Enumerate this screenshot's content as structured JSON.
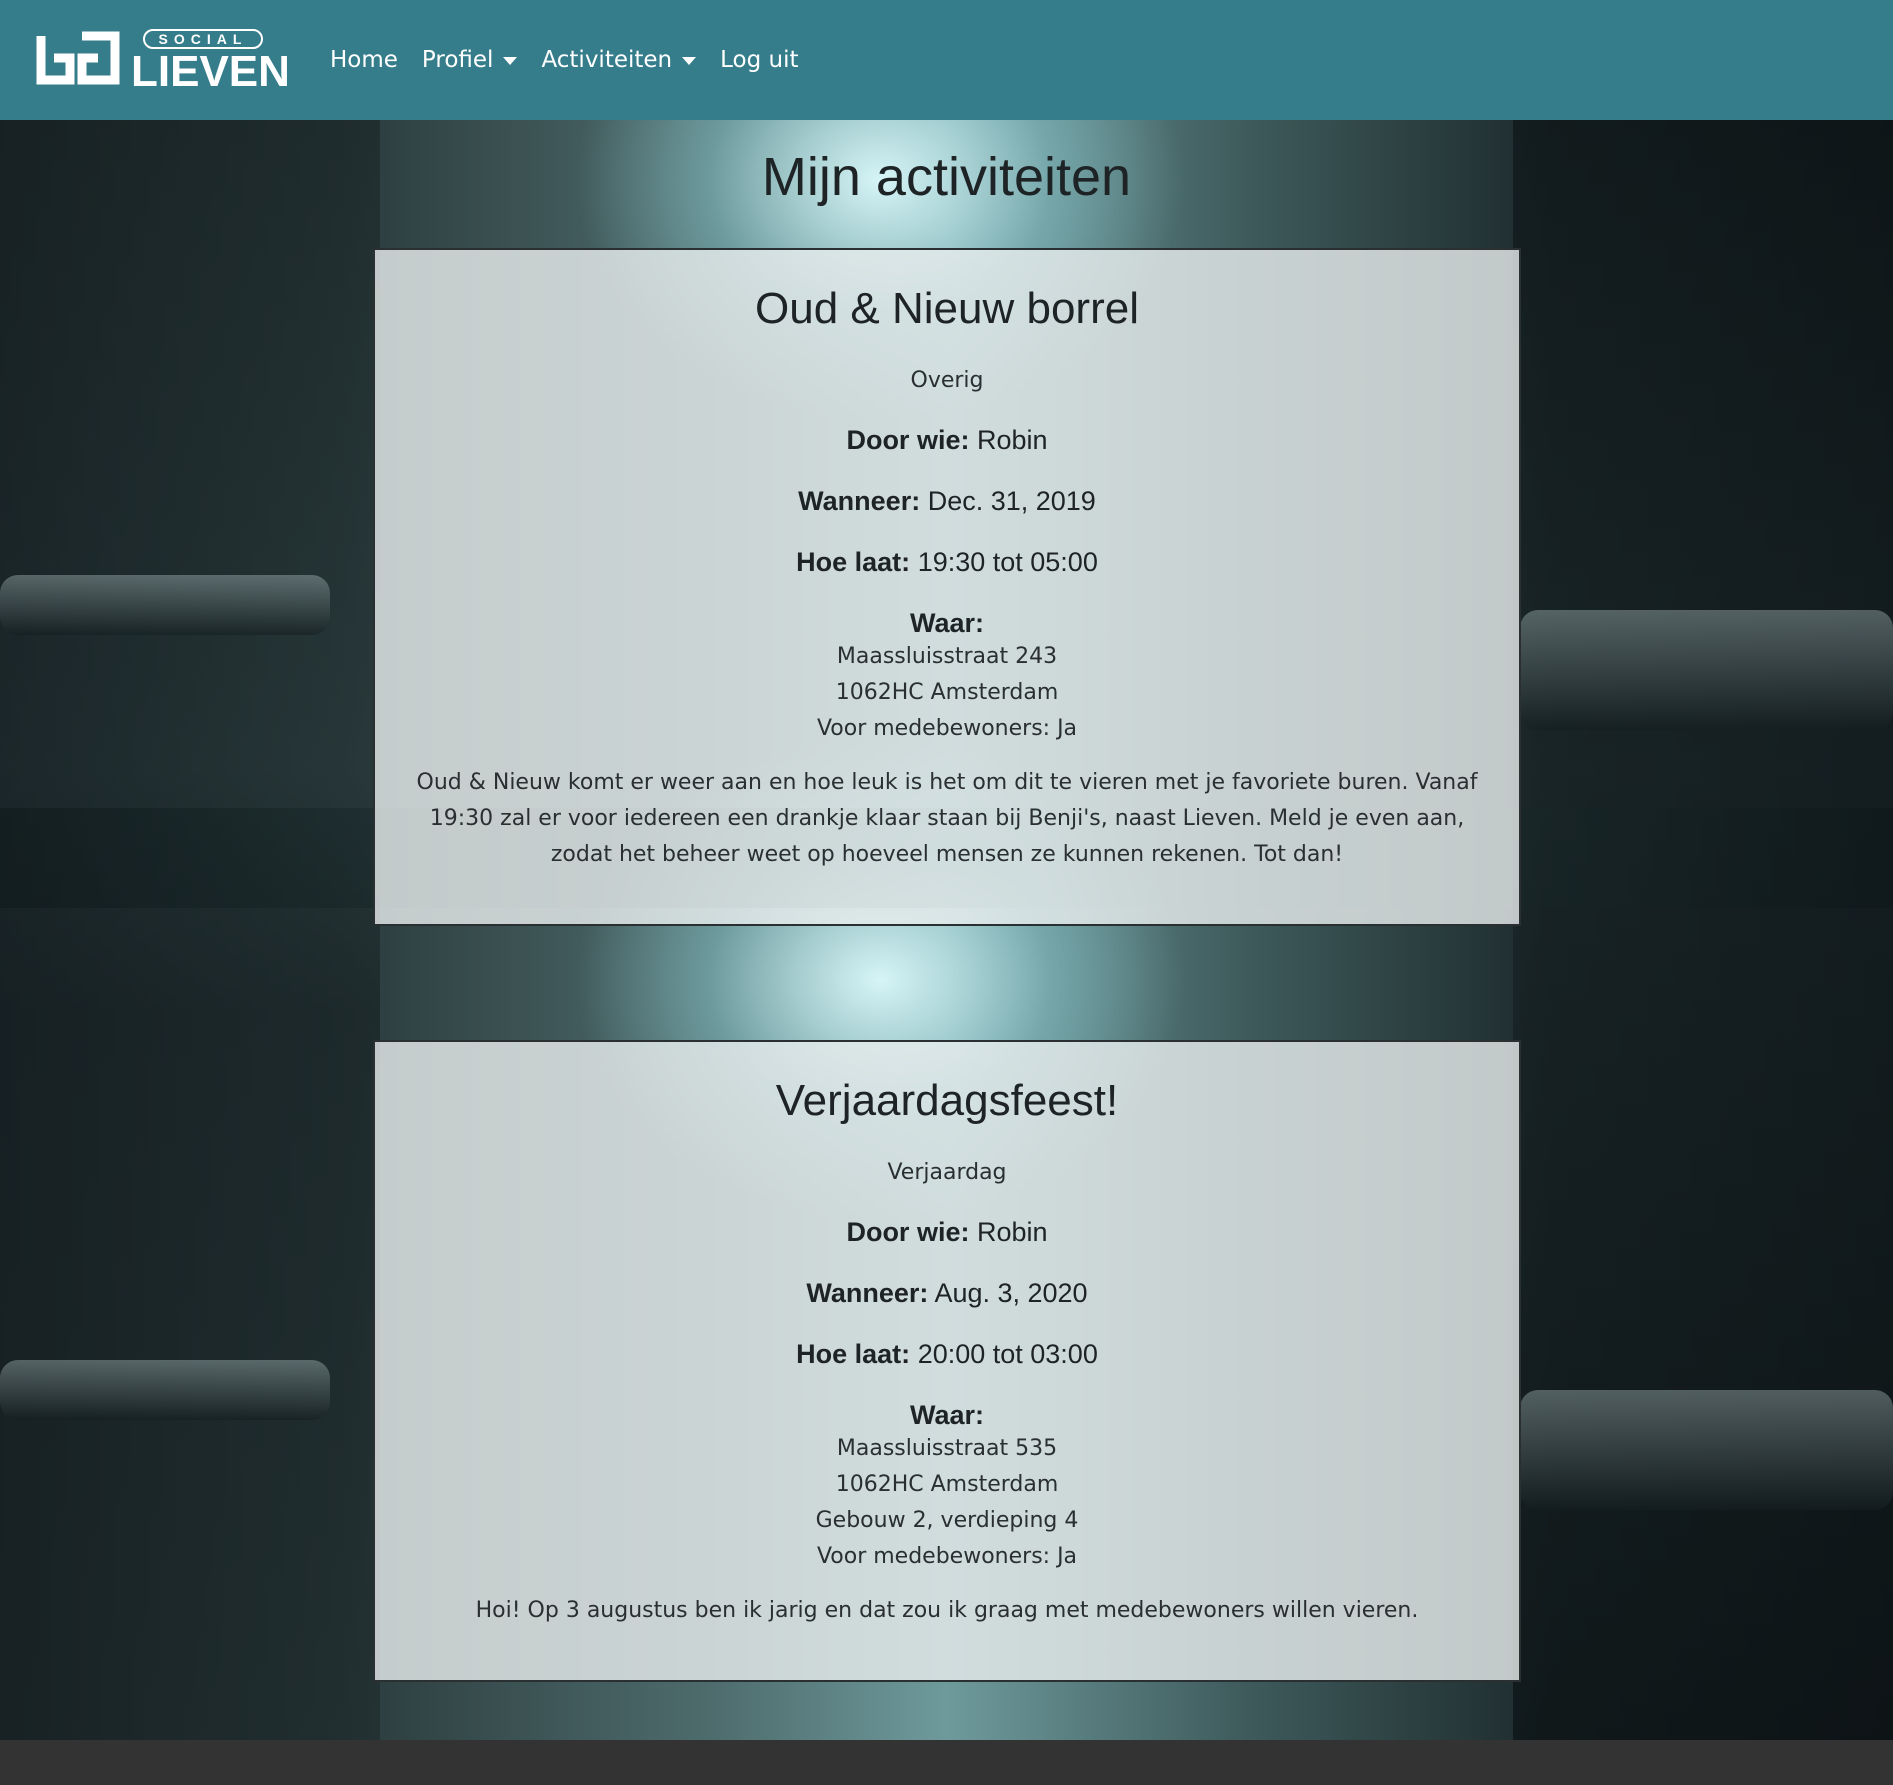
{
  "nav": {
    "logo_top": "SOCIAL",
    "logo_main": "LIEVEN",
    "links": [
      {
        "label": "Home"
      },
      {
        "label": "Profiel"
      },
      {
        "label": "Activiteiten"
      },
      {
        "label": "Log uit"
      }
    ]
  },
  "page": {
    "title": "Mijn activiteiten"
  },
  "activities": [
    {
      "title": "Oud & Nieuw borrel",
      "category": "Overig",
      "who_label": "Door wie:",
      "who": "Robin",
      "when_label": "Wanneer:",
      "when": "Dec. 31, 2019",
      "time_label": "Hoe laat:",
      "time": "19:30 tot 05:00",
      "where_label": "Waar:",
      "address": [
        "Maassluisstraat 243",
        "1062HC Amsterdam",
        "Voor medebewoners: Ja"
      ],
      "description": "Oud & Nieuw komt er weer aan en hoe leuk is het om dit te vieren met je favoriete buren. Vanaf 19:30 zal er voor iedereen een drankje klaar staan bij Benji's, naast Lieven. Meld je even aan, zodat het beheer weet op hoeveel mensen ze kunnen rekenen. Tot dan!"
    },
    {
      "title": "Verjaardagsfeest!",
      "category": "Verjaardag",
      "who_label": "Door wie:",
      "who": "Robin",
      "when_label": "Wanneer:",
      "when": "Aug. 3, 2020",
      "time_label": "Hoe laat:",
      "time": "20:00 tot 03:00",
      "where_label": "Waar:",
      "address": [
        "Maassluisstraat 535",
        "1062HC Amsterdam",
        "Gebouw 2, verdieping 4",
        "Voor medebewoners: Ja"
      ],
      "description": "Hoi! Op 3 augustus ben ik jarig en dat zou ik graag met medebewoners willen vieren."
    }
  ],
  "colors": {
    "navbar": "#357d8a",
    "footer": "#333333"
  },
  "icons": {
    "dropdown": "caret-down-icon"
  }
}
